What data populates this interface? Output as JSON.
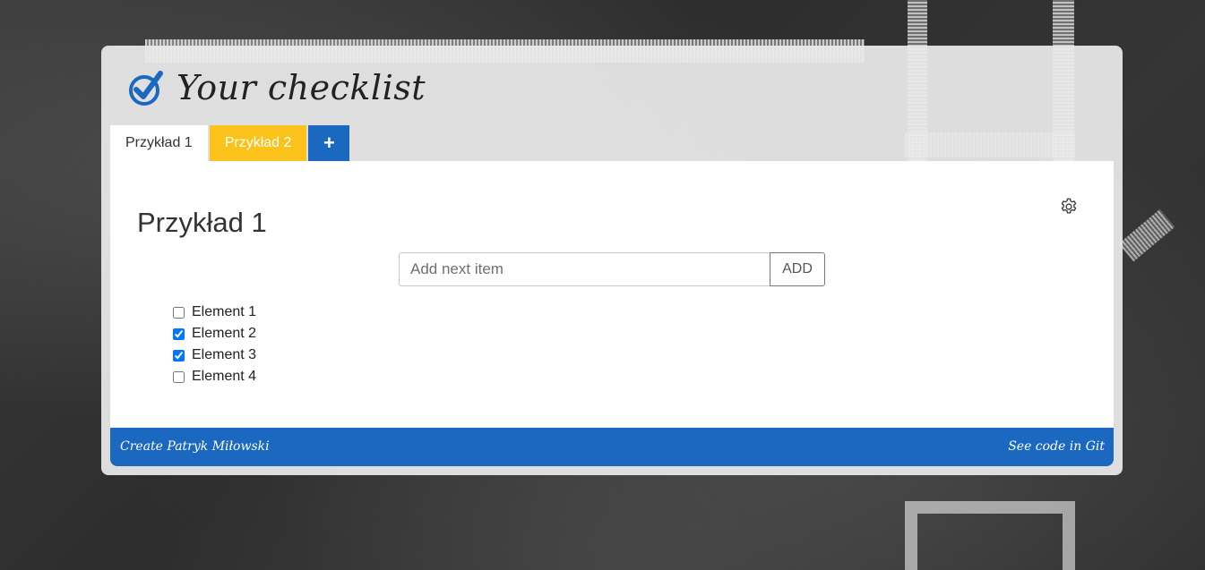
{
  "app": {
    "title": "Your checklist",
    "icon": "check-circle-icon",
    "accent_color": "#1b68c1"
  },
  "tabs": [
    {
      "label": "Przykład 1",
      "active": true,
      "color": "#ffffff"
    },
    {
      "label": "Przykład 2",
      "active": false,
      "color": "#fbc21b"
    }
  ],
  "add_tab": {
    "icon": "plus-icon",
    "label": "+"
  },
  "list": {
    "title": "Przykład 1",
    "settings_icon": "gear-icon",
    "input": {
      "placeholder": "Add next item",
      "value": ""
    },
    "add_button_label": "ADD",
    "items": [
      {
        "label": "Element 1",
        "checked": false
      },
      {
        "label": "Element 2",
        "checked": true
      },
      {
        "label": "Element 3",
        "checked": true
      },
      {
        "label": "Element 4",
        "checked": false
      }
    ]
  },
  "footer": {
    "left_text": "Create Patryk Miłowski",
    "right_text": "See code in Git"
  }
}
